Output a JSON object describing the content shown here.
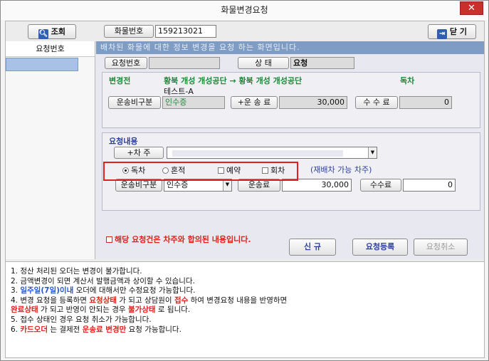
{
  "window": {
    "title": "화물변경요청",
    "close_label": "✕"
  },
  "toolbar": {
    "search_label": "조회",
    "cargo_no_label": "화물번호",
    "cargo_no_value": "159213021",
    "close_label": "닫 기"
  },
  "left": {
    "header": "요청번호"
  },
  "info_strip": "배차된 화물에 대한 정보 변경을 요청 하는 화면입니다.",
  "status_row": {
    "request_no_label": "요청번호",
    "request_no_value": "",
    "status_label": "상   태",
    "status_value": "요청"
  },
  "before": {
    "title": "변경전",
    "route": "황북 개성 개성공단 → 황북 개성 개성공단",
    "vehicle_type": "독차",
    "sub_name": "테스트-A",
    "cost_type_label": "운송비구분",
    "cost_type_value": "인수증",
    "fare_label": "+운 송 료",
    "fare_value": "30,000",
    "fee_label": "수 수 료",
    "fee_value": "0"
  },
  "request": {
    "title": "요청내용",
    "owner_label": "+차   주",
    "owner_value": "",
    "radio_solo": "독차",
    "radio_mixed": "혼적",
    "check_reserve": "예약",
    "check_return": "회차",
    "redispatch_note": "(재배차 가능 차주)",
    "cost_type_label": "운송비구분",
    "cost_type_value": "인수증",
    "fare_label": "운송료",
    "fare_value": "30,000",
    "fee_label": "수수료",
    "fee_value": "0",
    "agree_text": "해당 요청건은 차주와  합의된 내용입니다."
  },
  "actions": {
    "new_label": "신  규",
    "register_label": "요청등록",
    "cancel_label": "요청취소"
  },
  "notes": {
    "n1": "1. 정산 처리된 오더는 변경이 불가합니다.",
    "n2": "2. 금액변경이 되면 계산서 발행금액과 상이할 수 있습니다.",
    "n3_prefix": "3. ",
    "n3_hl": "일주일(7일)이내",
    "n3_rest": " 오더에 대해서만 수정요청 가능합니다.",
    "n4_a": "4. 변경 요청을 등록하면 ",
    "n4_hl1": "요청상태",
    "n4_b": " 가 되고 상담원이 ",
    "n4_hl2": "접수",
    "n4_c": " 하여 변경요청 내용을 반영하면",
    "n4_hl3": "완료상태",
    "n4_d": " 가 되고 반영이 안되는 경우 ",
    "n4_hl4": "불가상태",
    "n4_e": " 로 됩니다.",
    "n5": "5. 접수 상태인 경우 요청 취소가 가능합니다.",
    "n6_prefix": "6. ",
    "n6_hl1": "카드오더",
    "n6_b": " 는 결제전 ",
    "n6_hl2": "운송료 변경만",
    "n6_c": " 요청 가능합니다."
  },
  "colors": {
    "accent_red": "#e0201a",
    "accent_blue": "#2255dd",
    "strip": "#7e9cc4"
  }
}
